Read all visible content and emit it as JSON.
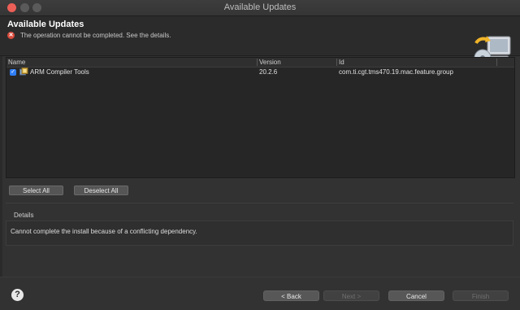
{
  "window": {
    "title": "Available Updates"
  },
  "header": {
    "title": "Available Updates",
    "message": "The operation cannot be completed.  See the details."
  },
  "table": {
    "columns": [
      "Name",
      "Version",
      "Id"
    ],
    "rows": [
      {
        "checked": true,
        "name": "ARM Compiler Tools",
        "version": "20.2.6",
        "id": "com.ti.cgt.tms470.19.mac.feature.group"
      }
    ]
  },
  "selection": {
    "select_all": "Select All",
    "deselect_all": "Deselect All"
  },
  "details": {
    "label": "Details",
    "text": "Cannot complete the install because of a conflicting dependency."
  },
  "footer": {
    "help": "?",
    "back": "< Back",
    "next": "Next >",
    "cancel": "Cancel",
    "finish": "Finish"
  },
  "colors": {
    "accent": "#2f7ef6",
    "error": "#d84a3b",
    "close": "#ec5f57"
  },
  "icons": [
    "error-icon",
    "update-banner-icon",
    "feature-package-icon",
    "checkmark-icon",
    "help-icon"
  ]
}
